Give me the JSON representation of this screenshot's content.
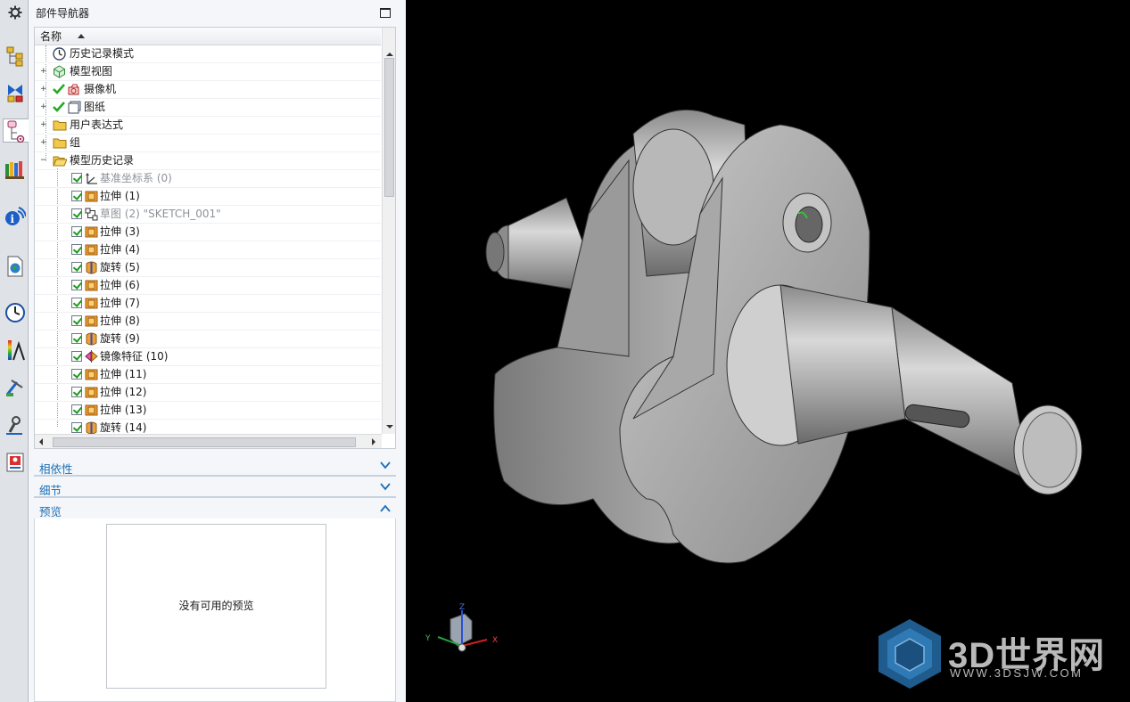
{
  "navigator": {
    "title": "部件导航器",
    "column_header": "名称",
    "top_nodes": [
      {
        "label": "历史记录模式",
        "icon": "clock-icon"
      },
      {
        "label": "模型视图",
        "icon": "model-views-icon"
      },
      {
        "label": "摄像机",
        "icon": "camera-icon"
      },
      {
        "label": "图纸",
        "icon": "drawing-sheet-icon"
      },
      {
        "label": "用户表达式",
        "icon": "folder-icon"
      },
      {
        "label": "组",
        "icon": "folder-icon"
      },
      {
        "label": "模型历史记录",
        "icon": "folder-open-icon"
      }
    ],
    "features": [
      {
        "label": "基准坐标系 (0)",
        "icon": "datum-csys-icon",
        "dimmed": true
      },
      {
        "label": "拉伸 (1)",
        "icon": "extrude-icon",
        "dimmed": false
      },
      {
        "label": "草图 (2) \"SKETCH_001\"",
        "icon": "sketch-icon",
        "dimmed": true
      },
      {
        "label": "拉伸 (3)",
        "icon": "extrude-icon",
        "dimmed": false
      },
      {
        "label": "拉伸 (4)",
        "icon": "extrude-icon",
        "dimmed": false
      },
      {
        "label": "旋转 (5)",
        "icon": "revolve-icon",
        "dimmed": false
      },
      {
        "label": "拉伸 (6)",
        "icon": "extrude-icon",
        "dimmed": false
      },
      {
        "label": "拉伸 (7)",
        "icon": "extrude-icon",
        "dimmed": false
      },
      {
        "label": "拉伸 (8)",
        "icon": "extrude-icon",
        "dimmed": false
      },
      {
        "label": "旋转 (9)",
        "icon": "revolve-icon",
        "dimmed": false
      },
      {
        "label": "镜像特征 (10)",
        "icon": "mirror-feature-icon",
        "dimmed": false
      },
      {
        "label": "拉伸 (11)",
        "icon": "extrude-icon",
        "dimmed": false
      },
      {
        "label": "拉伸 (12)",
        "icon": "extrude-icon",
        "dimmed": false
      },
      {
        "label": "拉伸 (13)",
        "icon": "extrude-icon",
        "dimmed": false
      },
      {
        "label": "旋转 (14)",
        "icon": "revolve-icon",
        "dimmed": false
      }
    ],
    "sections": {
      "dependencies": "相依性",
      "details": "细节",
      "preview": "预览"
    },
    "preview_empty_text": "没有可用的预览"
  },
  "resource_bar": {
    "icons": [
      "gear-icon",
      "assembly-navigator-icon",
      "constraint-navigator-icon",
      "part-navigator-icon",
      "reuse-library-icon",
      "hd3d-tools-icon",
      "web-browser-icon",
      "history-icon",
      "system-materials-icon",
      "process-studio-icon",
      "manufacturing-wizard-icon",
      "roles-icon"
    ]
  },
  "viewport": {
    "triad_labels": {
      "x": "X",
      "y": "Y",
      "z": "Z"
    },
    "watermark": {
      "main": "3D世界网",
      "sub": "WWW.3DSJW.COM"
    }
  },
  "colors": {
    "accent": "#1a6fb8",
    "check_green": "#1e9a1e",
    "viewport_bg": "#000000",
    "model_gray": "#a8a8a8"
  }
}
